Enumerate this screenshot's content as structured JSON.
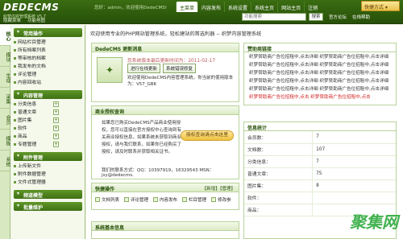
{
  "header": {
    "logo": "DEDECMS",
    "logo_sub": "织梦内容管理系统 V5.7",
    "links": [
      "隐藏菜单",
      "功能地图"
    ],
    "user_info": "您好：admin，欢迎使用DedeCMS!",
    "nav": [
      {
        "label": "主菜单",
        "active": true
      },
      {
        "label": "内容发布"
      },
      {
        "label": "系统设置"
      },
      {
        "label": "系统主页"
      },
      {
        "label": "网站主页"
      },
      {
        "label": "注销"
      }
    ],
    "quick_label": "快捷方式 ▾",
    "search_placeholder": "功能搜索",
    "search_button": "搜索",
    "sub_links": [
      "官方论坛",
      "在线帮助"
    ]
  },
  "sidebar_tabs": [
    "核心",
    "模块",
    "生成",
    "采集",
    "会员",
    "模板",
    "系统"
  ],
  "menu": {
    "groups": [
      {
        "title": "常用操作",
        "items": [
          {
            "label": "网站栏目管理"
          },
          {
            "label": "所有档案列表"
          },
          {
            "label": "等审核的档案"
          },
          {
            "label": "我发布的文档"
          },
          {
            "label": "评论管理"
          },
          {
            "label": "内容回收站"
          }
        ]
      },
      {
        "title": "内容管理",
        "items": [
          {
            "label": "分类信息",
            "add": "+"
          },
          {
            "label": "普通文章",
            "add": "+"
          },
          {
            "label": "图片集",
            "add": "+"
          },
          {
            "label": "软件",
            "add": "+"
          },
          {
            "label": "商品",
            "add": "+"
          },
          {
            "label": "专题管理",
            "add": "+"
          }
        ]
      },
      {
        "title": "附件管理",
        "items": [
          {
            "label": "上传新文件"
          },
          {
            "label": "附件数据管理"
          },
          {
            "label": "文件式管理器"
          }
        ]
      },
      {
        "title": "频道模型",
        "items": []
      },
      {
        "title": "批量维护",
        "items": []
      }
    ]
  },
  "main": {
    "welcome": "欢迎使用专业的PHP网站管理系统，轻松建站的首选利器 -- 织梦内容管理系统",
    "update": {
      "title": "DedeCMS 更新消息",
      "notice": "您系统版本最后更新时间为：2011-02-17",
      "btn_update": "进行在线更新",
      "btn_check": "系统错误修复",
      "desc": "欢迎使用DedeCMS内容管理系统，你当前的使用版本为：V57_GBK"
    },
    "license": {
      "title": "商业授权查询",
      "text": "如果您已购买DedeCMS产品商业使用授权，您可以直接在官方授权中心查询到有关商业授权信息，如果系统未获取到商业授权，请与我们联系，如果你已经购买了授权，请及时联系并获取相关证书。",
      "badge": "授权查询请点击这里",
      "contact": "我们的联系方式：QQ：10397919，16329543 MSN：jsy@dedecms."
    },
    "quick_menu": {
      "title": "快捷操作",
      "links": "【新增】【管理】",
      "items": [
        "文档列表",
        "评论管理",
        "内容发布",
        "栏目管理",
        "修改参"
      ]
    },
    "sysinfo": {
      "title": "系统基本信息"
    },
    "ads": {
      "title": "赞助商链接",
      "rows": [
        {
          "text": "织梦赞助商广告位招租中,点击详细  织梦赞助商广告位招租中,点击详细",
          "red": false
        },
        {
          "text": "织梦赞助商广告位招租中,点击详细  织梦赞助商广告位招租中,点击详细",
          "red": false
        },
        {
          "text": "织梦赞助商广告位招租中,点击详细  织梦赞助商广告位招租中,点击详细",
          "red": false
        },
        {
          "text": "织梦赞助商广告位招租中,点击详细  织梦赞助商广告位招租中,点击详细",
          "red": false
        },
        {
          "text": "织梦赞助商广告位招租中,点击详细  织梦赞助商广告位招租中,点击详细",
          "red": false
        },
        {
          "text": "织梦赞助商广告位招租中,点击  织梦赞助商广告位招租中,点击",
          "red": true
        }
      ]
    },
    "stats": {
      "title": "信息统计",
      "rows": [
        {
          "label": "会员数：",
          "value": "7"
        },
        {
          "label": "文档数：",
          "value": "107"
        },
        {
          "label": "分类信息：",
          "value": "7"
        },
        {
          "label": "普通文章：",
          "value": "75"
        },
        {
          "label": "图片集：",
          "value": "8"
        },
        {
          "label": "软件：",
          "value": ""
        },
        {
          "label": "商品：",
          "value": ""
        }
      ]
    },
    "watermark": "聚集网"
  }
}
